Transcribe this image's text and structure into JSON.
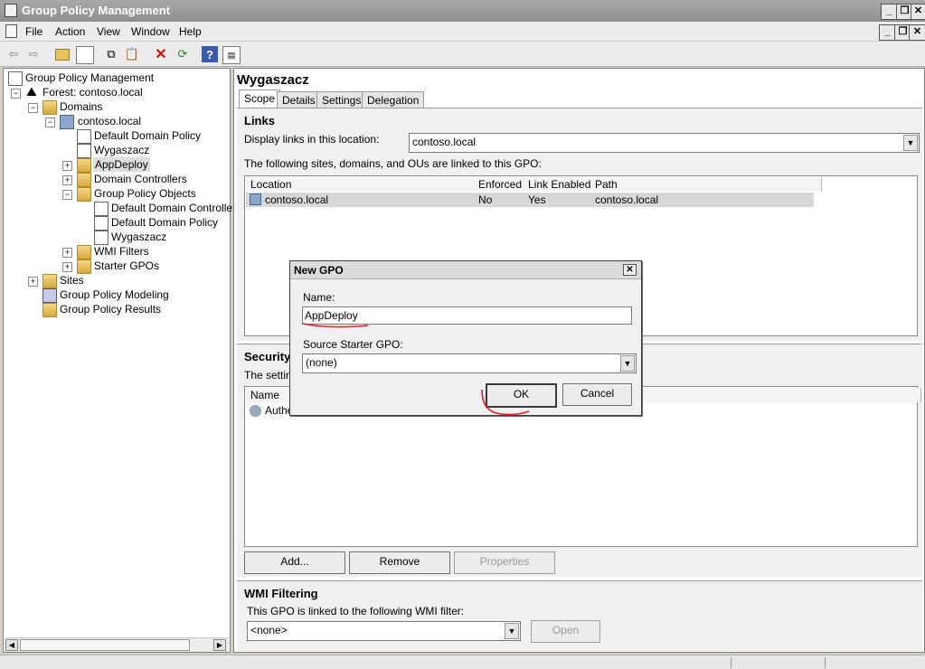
{
  "window": {
    "title": "Group Policy Management"
  },
  "menu": [
    "File",
    "Action",
    "View",
    "Window",
    "Help"
  ],
  "toolbar_icons": [
    "back-arrow-icon",
    "forward-arrow-icon",
    "up-folder-icon",
    "show-hide-tree-icon",
    "copy-icon",
    "paste-icon",
    "delete-icon",
    "refresh-icon",
    "help-icon",
    "properties-icon"
  ],
  "tree": {
    "root": "Group Policy Management",
    "forest": "Forest: contoso.local",
    "domains": "Domains",
    "domain": "contoso.local",
    "items": {
      "default_domain_policy": "Default Domain Policy",
      "wygaszacz": "Wygaszacz",
      "appdeploy": "AppDeploy",
      "domain_controllers": "Domain Controllers",
      "gpo_folder": "Group Policy Objects",
      "gpo_ddc": "Default Domain Controllers",
      "gpo_ddp": "Default Domain Policy",
      "gpo_wyg": "Wygaszacz",
      "wmi_filters": "WMI Filters",
      "starter_gpos": "Starter GPOs",
      "sites": "Sites",
      "modeling": "Group Policy Modeling",
      "results": "Group Policy Results"
    }
  },
  "details": {
    "title": "Wygaszacz",
    "tabs": [
      "Scope",
      "Details",
      "Settings",
      "Delegation"
    ],
    "links": {
      "heading": "Links",
      "display_label": "Display links in this location:",
      "display_value": "contoso.local",
      "description": "The following sites, domains, and OUs are linked to this GPO:",
      "columns": [
        "Location",
        "Enforced",
        "Link Enabled",
        "Path"
      ],
      "row": [
        "contoso.local",
        "No",
        "Yes",
        "contoso.local"
      ]
    },
    "security": {
      "heading": "Security",
      "description": "The setting",
      "column": "Name",
      "row": "Authe",
      "buttons": {
        "add": "Add...",
        "remove": "Remove",
        "properties": "Properties"
      }
    },
    "wmi": {
      "heading": "WMI Filtering",
      "description": "This GPO is linked to the following WMI filter:",
      "value": "<none>",
      "open": "Open"
    }
  },
  "dialog": {
    "title": "New GPO",
    "name_label": "Name:",
    "name_value": "AppDeploy",
    "starter_label": "Source Starter GPO:",
    "starter_value": "(none)",
    "ok": "OK",
    "cancel": "Cancel"
  },
  "annotation_color": "#e0202a"
}
